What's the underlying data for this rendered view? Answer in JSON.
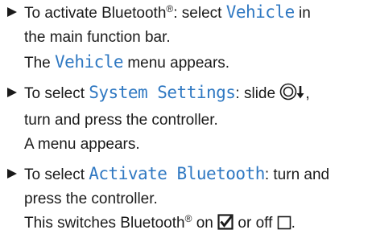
{
  "steps": [
    {
      "line1": {
        "a": "To activate Bluetooth",
        "reg": "®",
        "b": ": select ",
        "kw": "Vehicle",
        "c": " in"
      },
      "line2": "the main function bar.",
      "result": {
        "a": "The ",
        "kw": "Vehicle",
        "b": " menu appears."
      }
    },
    {
      "line1": {
        "a": "To select ",
        "kw": "System Settings",
        "b": ": slide ",
        "c": ","
      },
      "line2": "turn and press the controller.",
      "result": "A menu appears.",
      "icon": "controller-slide-down-icon"
    },
    {
      "line1": {
        "a": "To select ",
        "kw": "Activate Bluetooth",
        "b": ": turn and"
      },
      "line2": "press the controller.",
      "result": {
        "a": "This switches Bluetooth",
        "reg": "®",
        "b": " on ",
        "c": " or off ",
        "d": "."
      },
      "icons": [
        "checkbox-checked-icon",
        "checkbox-empty-icon"
      ]
    }
  ],
  "colors": {
    "text": "#1a1a1a",
    "keyword": "#2f78c2"
  }
}
